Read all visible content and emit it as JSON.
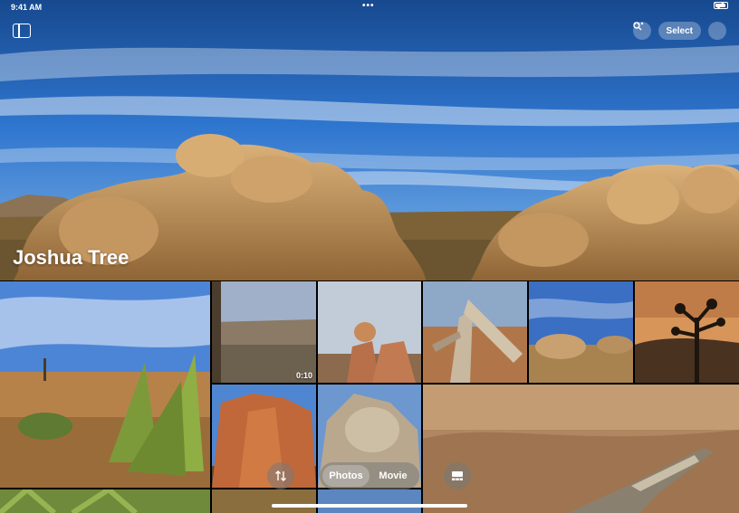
{
  "status": {
    "time": "9:41 AM",
    "dots": "•••"
  },
  "toolbar": {
    "select_label": "Select",
    "search_icon": "search-icon",
    "more_icon": "ellipsis-icon",
    "sidebar_icon": "sidebar-icon"
  },
  "album": {
    "title": "Joshua Tree"
  },
  "grid": {
    "video_duration": "0:10"
  },
  "bottom": {
    "sort_icon": "sort-arrows-icon",
    "segments": [
      {
        "label": "Photos",
        "active": true
      },
      {
        "label": "Movie",
        "active": false
      }
    ],
    "layout_icon": "layout-icon"
  },
  "colors": {
    "sky_top": "#1d5fb8",
    "sky_bottom": "#6aa5e0",
    "rock": "#c69a63",
    "ground": "#8a6b3c"
  }
}
